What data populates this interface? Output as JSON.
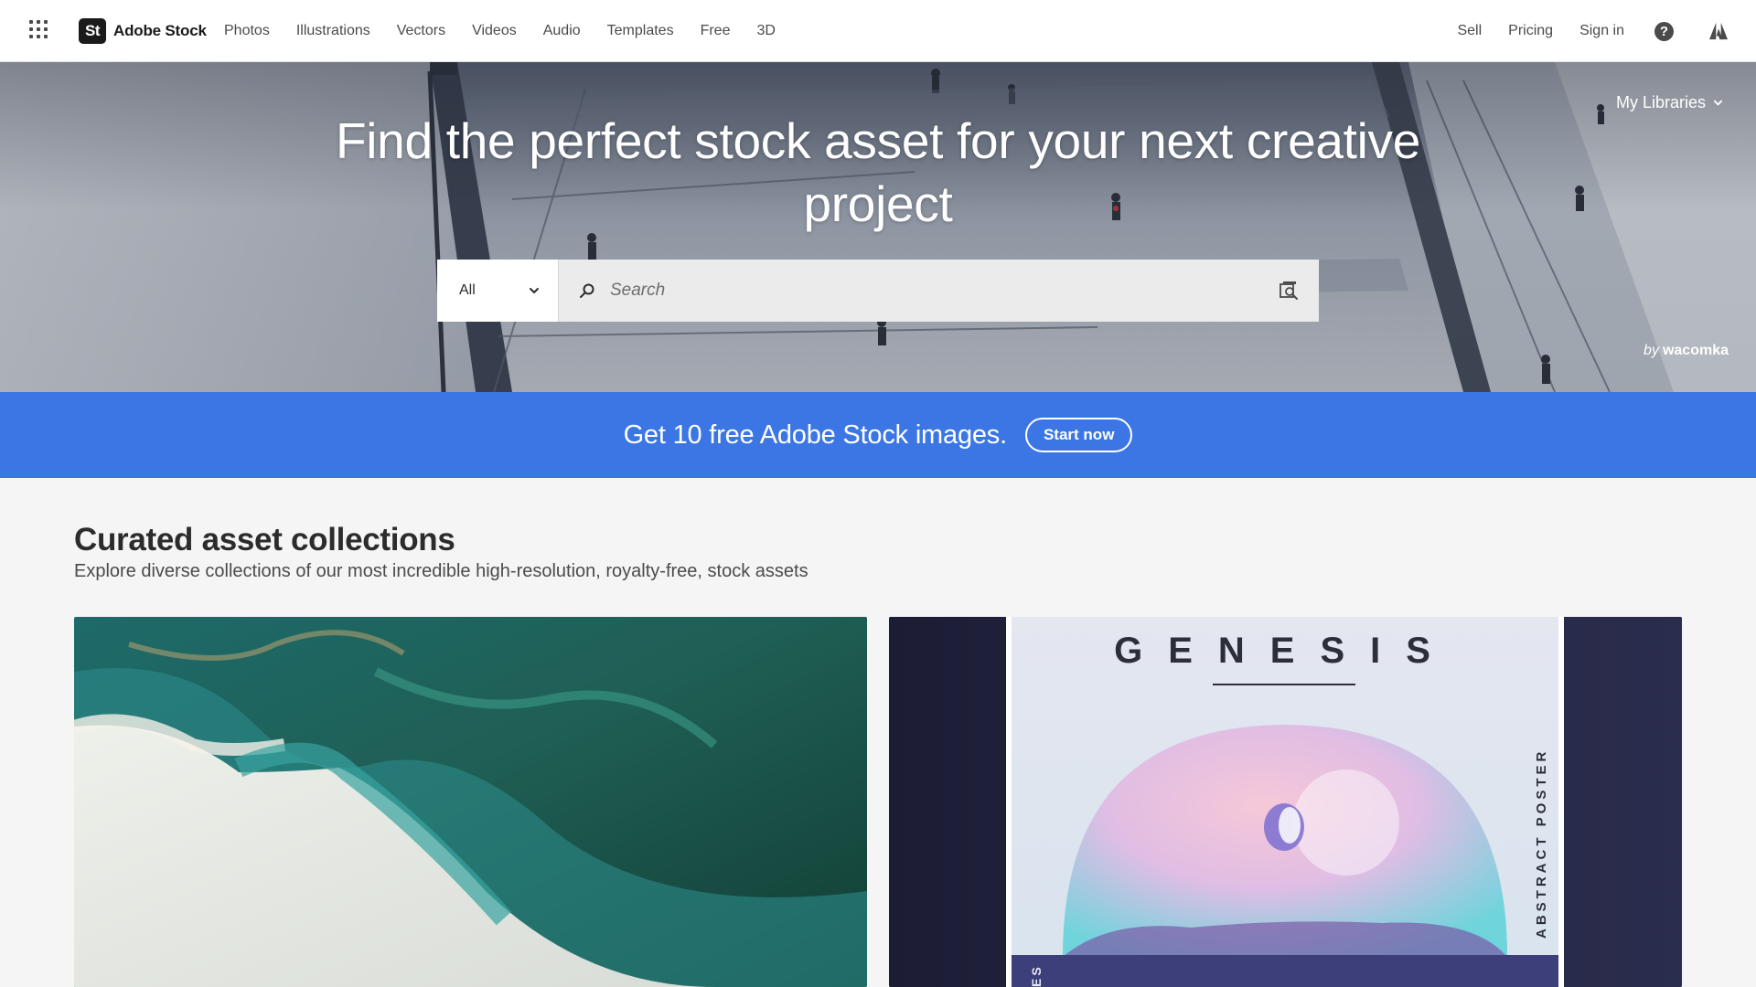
{
  "nav": {
    "brand_logo": "St",
    "brand_name": "Adobe Stock",
    "links": [
      "Photos",
      "Illustrations",
      "Vectors",
      "Videos",
      "Audio",
      "Templates",
      "Free",
      "3D"
    ],
    "right": {
      "sell": "Sell",
      "pricing": "Pricing",
      "sign_in": "Sign in"
    },
    "icons": [
      "app-switcher-icon",
      "help-icon",
      "adobe-icon"
    ]
  },
  "hero": {
    "title": "Find the perfect stock asset for your next creative project",
    "my_libraries": "My Libraries",
    "credit_by": "by",
    "credit_author": "wacomka",
    "search": {
      "type_value": "All",
      "placeholder": "Search"
    }
  },
  "promo": {
    "text": "Get 10 free Adobe Stock images.",
    "button": "Start now",
    "color": "#3b76e4"
  },
  "collections": {
    "title": "Curated asset collections",
    "subtitle": "Explore diverse collections of our most incredible high-resolution, royalty-free, stock assets",
    "cards": [
      {
        "name": "ocean-waves-collection"
      },
      {
        "name": "genesis-poster-collection",
        "poster_title": "GENESIS",
        "side_text": "ABSTRACT POSTER",
        "bottom_text": "ES"
      }
    ]
  }
}
